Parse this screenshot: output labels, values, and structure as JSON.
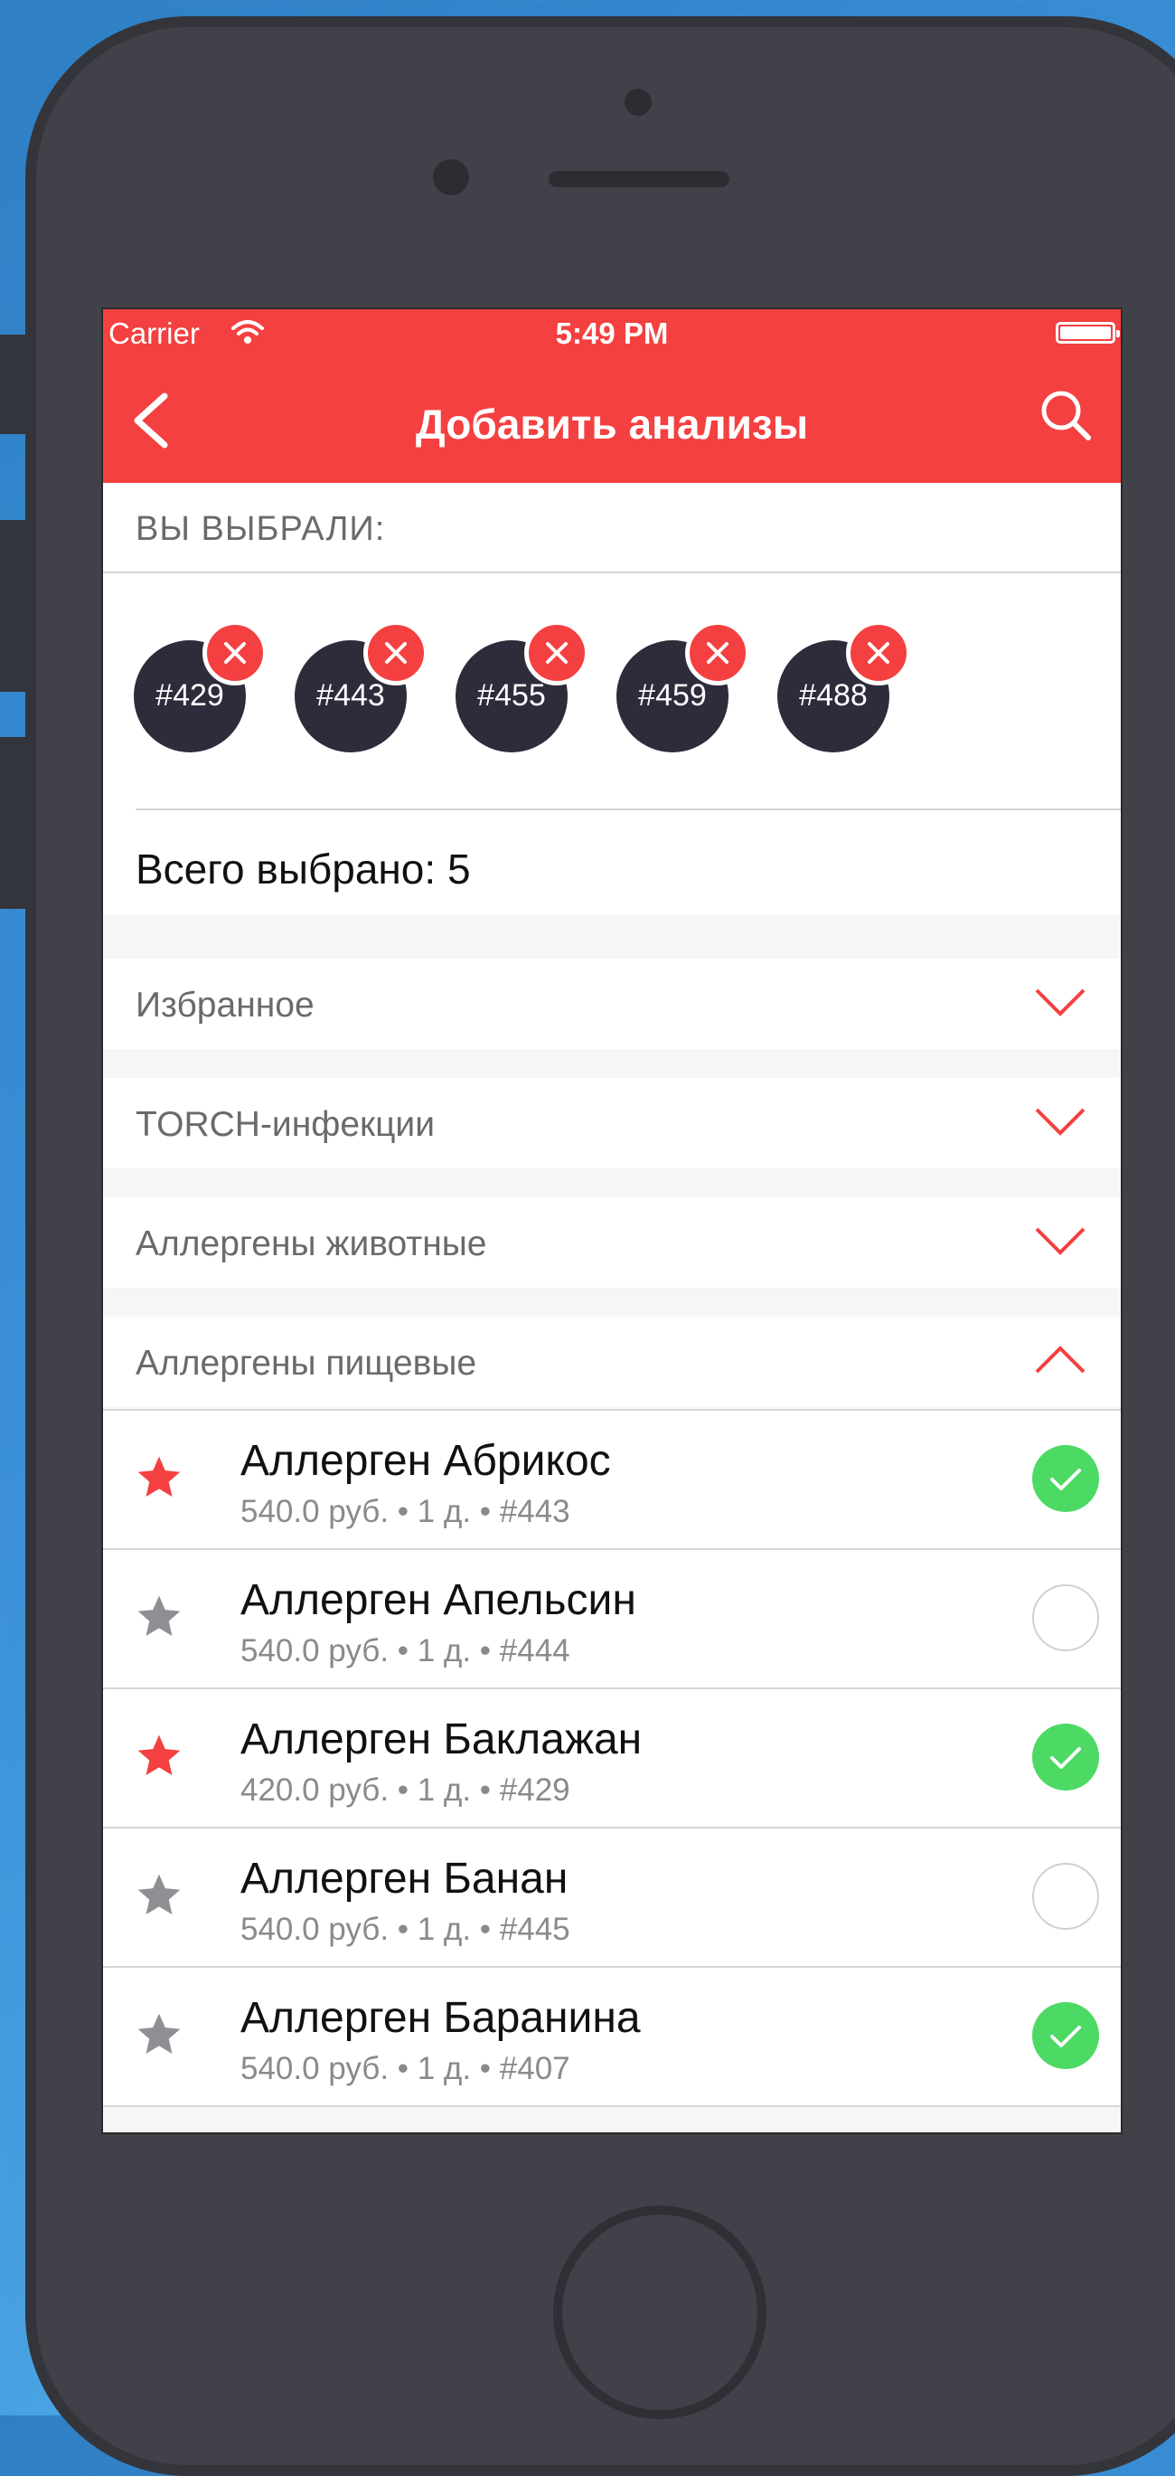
{
  "status_bar": {
    "carrier": "Carrier",
    "time": "5:49 PM"
  },
  "nav": {
    "title": "Добавить анализы"
  },
  "selected_header": "ВЫ ВЫБРАЛИ:",
  "chips": [
    "#429",
    "#443",
    "#455",
    "#459",
    "#488"
  ],
  "total_label": "Всего выбрано: 5",
  "groups": [
    {
      "label": "Избранное",
      "expanded": false
    },
    {
      "label": "TORCH-инфекции",
      "expanded": false
    },
    {
      "label": "Аллергены животные",
      "expanded": false
    },
    {
      "label": "Аллергены пищевые",
      "expanded": true
    }
  ],
  "items": [
    {
      "name": "Аллерген Абрикос",
      "meta": "540.0 руб. • 1 д. • #443",
      "favorite": true,
      "selected": true
    },
    {
      "name": "Аллерген Апельсин",
      "meta": "540.0 руб. • 1 д. • #444",
      "favorite": false,
      "selected": false
    },
    {
      "name": "Аллерген Баклажан",
      "meta": "420.0 руб. • 1 д. • #429",
      "favorite": true,
      "selected": true
    },
    {
      "name": "Аллерген Банан",
      "meta": "540.0 руб. • 1 д. • #445",
      "favorite": false,
      "selected": false
    },
    {
      "name": "Аллерген Баранина",
      "meta": "540.0 руб. • 1 д. • #407",
      "favorite": false,
      "selected": true
    }
  ],
  "colors": {
    "accent": "#f44040",
    "check_on": "#4cd964",
    "star_off": "#8e8e93",
    "chip_bg": "#2d2c3a"
  }
}
